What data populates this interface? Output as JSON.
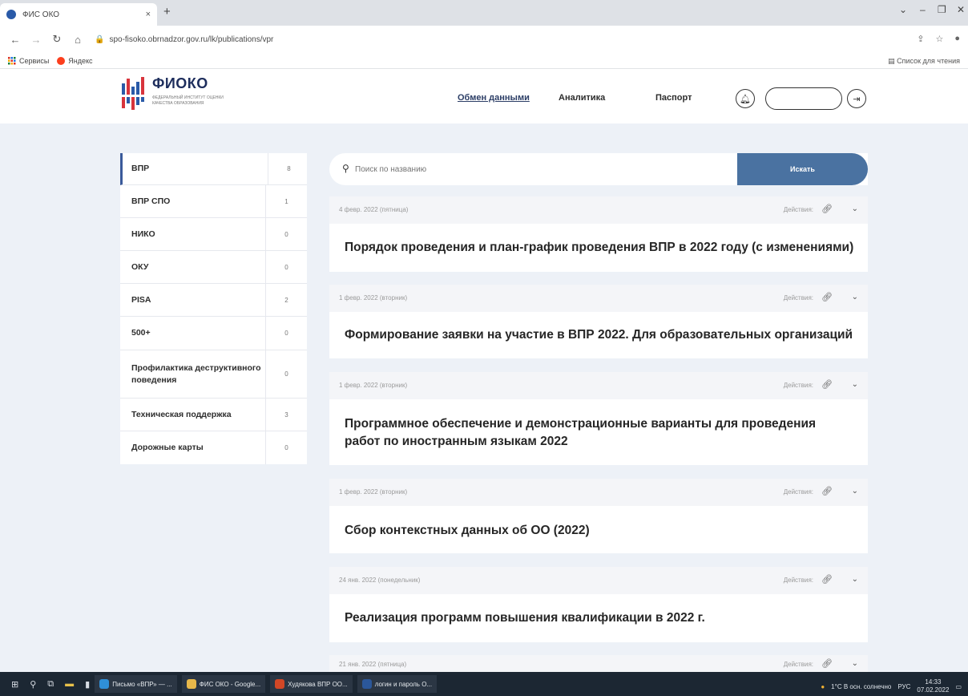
{
  "browser": {
    "tab_title": "ФИС ОКО",
    "tab_close": "×",
    "new_tab": "+",
    "url": "spo-fisoko.obrnadzor.gov.ru/lk/publications/vpr",
    "bookmarks": [
      "Сервисы",
      "Яндекс"
    ],
    "reading_list": "Список для чтения"
  },
  "header": {
    "logo": "ФИОКО",
    "logo_sub": "ФЕДЕРАЛЬНЫЙ ИНСТИТУТ ОЦЕНКИ КАЧЕСТВА ОБРАЗОВАНИЯ",
    "nav": [
      "Обмен данными",
      "Аналитика",
      "Паспорт"
    ]
  },
  "sidebar": {
    "items": [
      {
        "label": "ВПР",
        "count": "8"
      },
      {
        "label": "ВПР СПО",
        "count": "1"
      },
      {
        "label": "НИКО",
        "count": "0"
      },
      {
        "label": "ОКУ",
        "count": "0"
      },
      {
        "label": "PISA",
        "count": "2"
      },
      {
        "label": "500+",
        "count": "0"
      },
      {
        "label": "Профилактика деструктивного поведения",
        "count": "0"
      },
      {
        "label": "Техническая поддержка",
        "count": "3"
      },
      {
        "label": "Дорожные карты",
        "count": "0"
      }
    ]
  },
  "search": {
    "placeholder": "Поиск по названию",
    "button": "Искать"
  },
  "actions_label": "Действия:",
  "publications": [
    {
      "date": "4 февр. 2022 (пятница)",
      "title": "Порядок проведения и план-график проведения ВПР в 2022 году (с изменениями)"
    },
    {
      "date": "1 февр. 2022 (вторник)",
      "title": "Формирование заявки на участие в ВПР 2022. Для образовательных организаций"
    },
    {
      "date": "1 февр. 2022 (вторник)",
      "title": "Программное обеспечение и демонстрационные варианты для проведения работ по иностранным языкам 2022"
    },
    {
      "date": "1 февр. 2022 (вторник)",
      "title": "Сбор контекстных данных об ОО (2022)"
    },
    {
      "date": "24 янв. 2022 (понедельник)",
      "title": "Реализация программ повышения квалификации в 2022 г."
    },
    {
      "date": "21 янв. 2022 (пятница)",
      "title": ""
    }
  ],
  "taskbar": {
    "apps": [
      "Письмо «ВПР» — ...",
      "ФИС ОКО - Google...",
      "Худякова ВПР ОО...",
      "логин и пароль О..."
    ],
    "weather": "1°C В осн. солнечно",
    "lang": "РУС",
    "time": "14:33",
    "date": "07.02.2022"
  }
}
